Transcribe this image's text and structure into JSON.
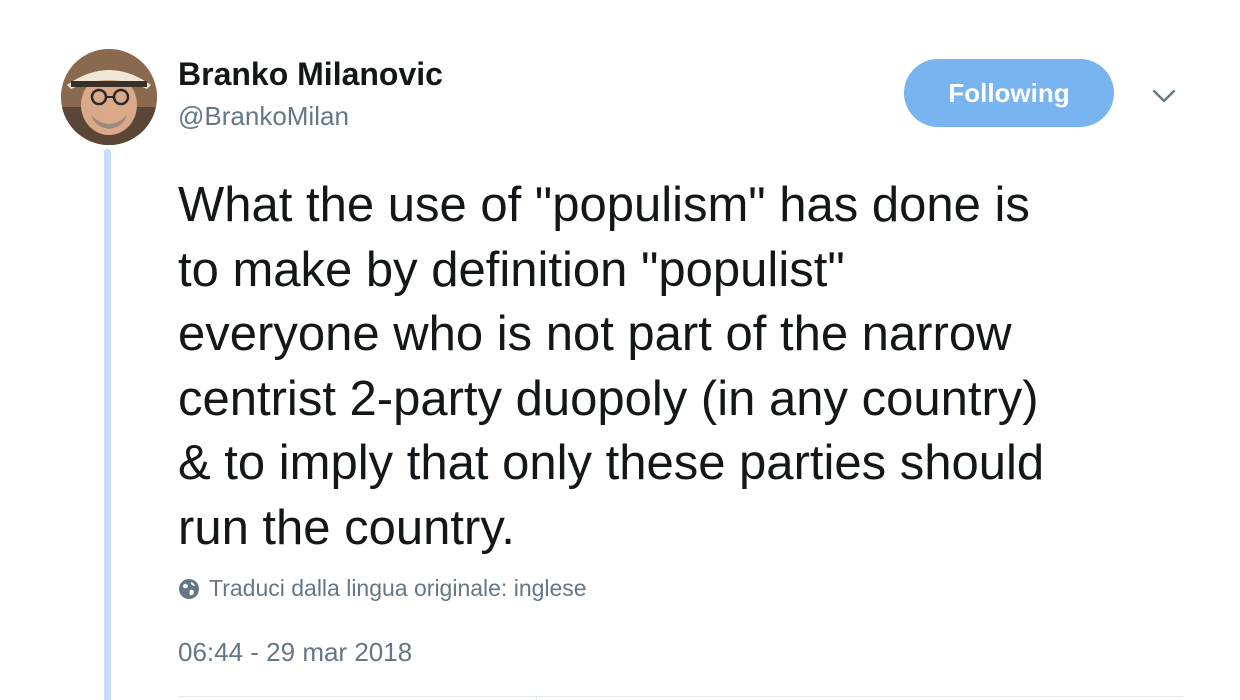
{
  "author": {
    "display_name": "Branko Milanovic",
    "handle": "@BrankoMilan"
  },
  "follow_button": {
    "label": "Following"
  },
  "tweet": {
    "lines": [
      "What the use of \"populism\" has done is",
      "to make by definition \"populist\"",
      "everyone who is not part of the narrow",
      "centrist 2-party duopoly (in any country)",
      "& to imply that only these parties should",
      "run the country."
    ],
    "translate_label": "Traduci dalla lingua originale: inglese",
    "timestamp": "06:44 - 29 mar 2018"
  },
  "icons": {
    "menu": "chevron-down-icon",
    "translate": "globe-icon"
  },
  "colors": {
    "follow_button_bg": "#78b5f0",
    "thread_line": "#c4def9",
    "text_primary": "#14171a",
    "text_secondary": "#657786"
  }
}
